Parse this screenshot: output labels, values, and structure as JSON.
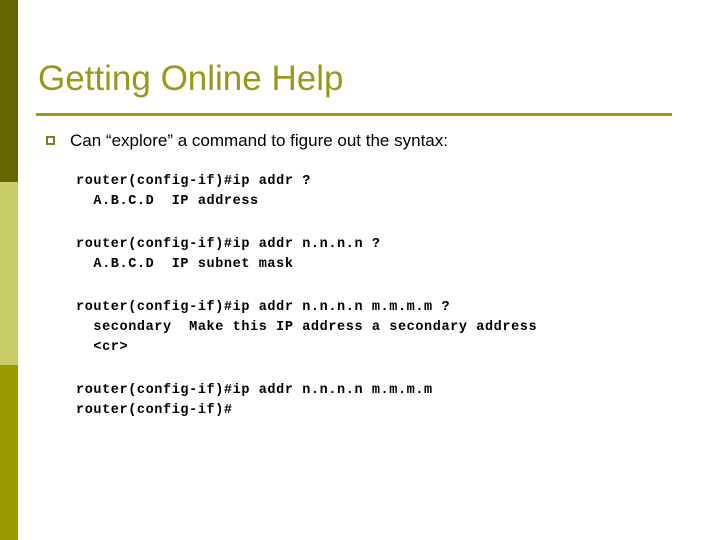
{
  "slide": {
    "title": "Getting Online Help",
    "bullet": {
      "marker": "hollow-square-bullet",
      "text": "Can “explore” a command to figure out the syntax:"
    },
    "code_blocks": [
      {
        "id": "block-1",
        "lines": [
          "router(config-if)#ip addr ?",
          "  A.B.C.D  IP address"
        ]
      },
      {
        "id": "block-2",
        "lines": [
          "router(config-if)#ip addr n.n.n.n ?",
          "  A.B.C.D  IP subnet mask"
        ]
      },
      {
        "id": "block-3",
        "lines": [
          "router(config-if)#ip addr n.n.n.n m.m.m.m ?",
          "  secondary  Make this IP address a secondary address",
          "  <cr>"
        ]
      },
      {
        "id": "block-4",
        "lines": [
          "router(config-if)#ip addr n.n.n.n m.m.m.m",
          "router(config-if)#"
        ]
      }
    ]
  },
  "theme": {
    "title_color": "#999919",
    "rule_color": "#999919",
    "bullet_color": "#7f7f19",
    "body_color": "#000000",
    "background": "#ffffff",
    "sidebar_top_color": "#666600",
    "sidebar_middle_color": "#c8cc66",
    "sidebar_bottom_color": "#999900"
  }
}
